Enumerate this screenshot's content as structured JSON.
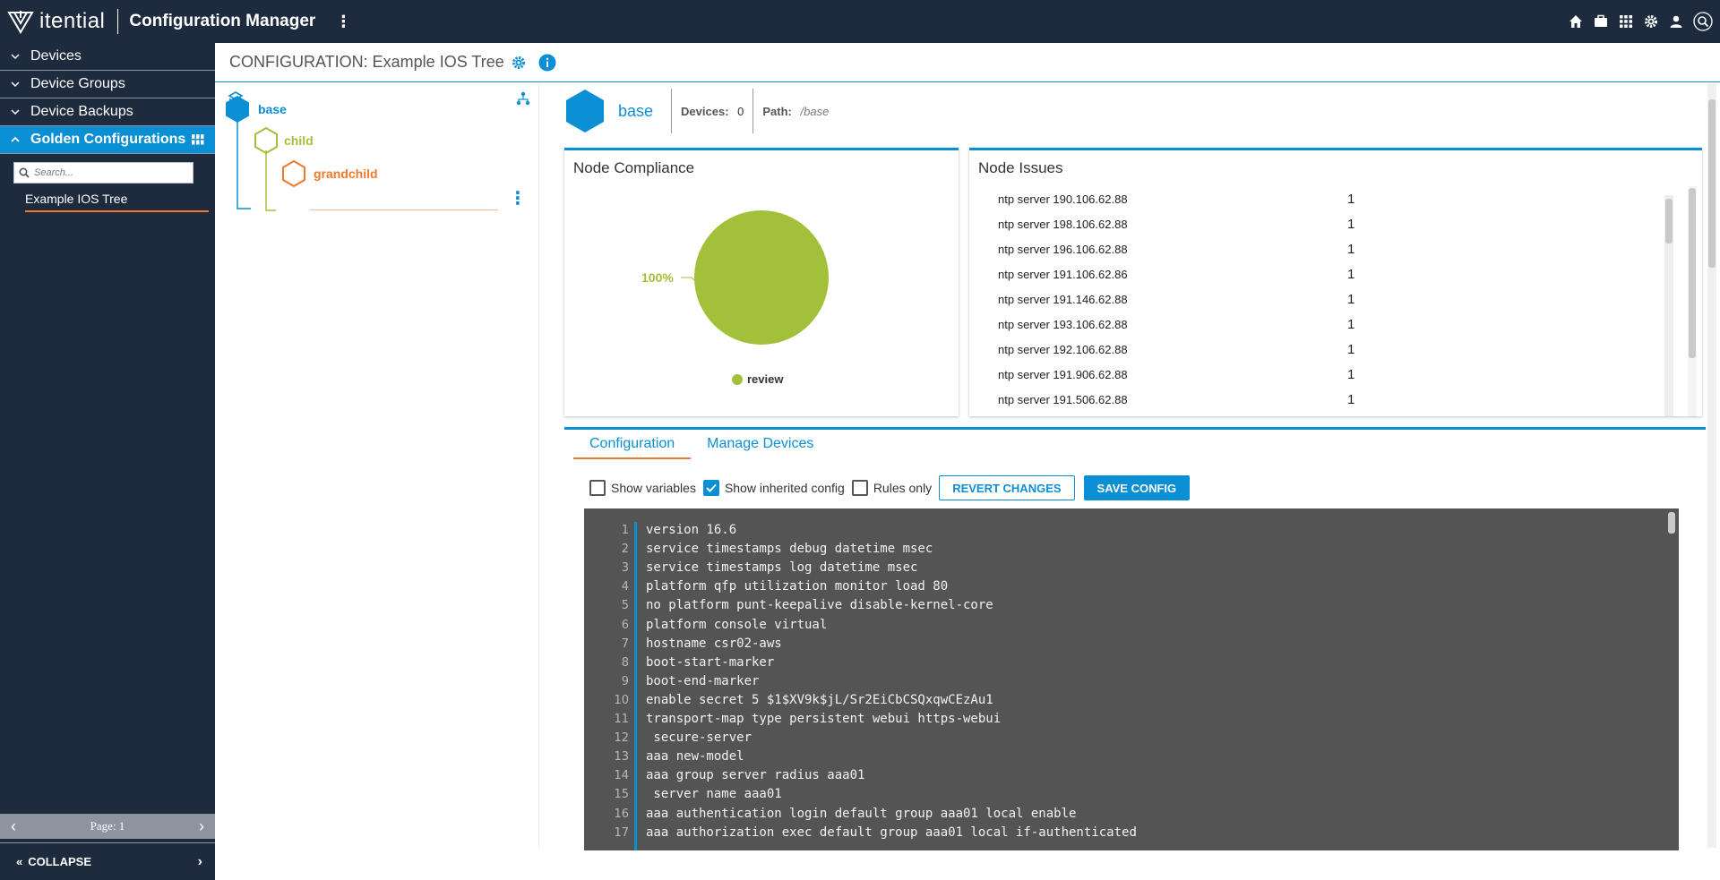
{
  "app": {
    "logo_text": "itential",
    "title": "Configuration Manager"
  },
  "topbar": {
    "icons": [
      "home-icon",
      "briefcase-icon",
      "apps-grid-icon",
      "settings-gear-icon",
      "user-icon",
      "search-icon"
    ]
  },
  "sidebar": {
    "items": [
      {
        "label": "Devices",
        "expanded": false
      },
      {
        "label": "Device Groups",
        "expanded": false
      },
      {
        "label": "Device Backups",
        "expanded": false
      },
      {
        "label": "Golden Configurations",
        "expanded": true
      }
    ],
    "search_placeholder": "Search...",
    "trees": [
      {
        "label": "Example IOS Tree"
      }
    ],
    "pager_label": "Page: 1",
    "collapse_label": "COLLAPSE"
  },
  "header": {
    "title": "CONFIGURATION: Example IOS Tree"
  },
  "tree": {
    "nodes": [
      {
        "label": "base",
        "color": "#0a8fd4"
      },
      {
        "label": "child",
        "color": "#a3c03b"
      },
      {
        "label": "grandchild",
        "color": "#f2792c"
      }
    ]
  },
  "node_info": {
    "name": "base",
    "devices_label": "Devices:",
    "devices_value": "0",
    "path_label": "Path:",
    "path_value": "/base"
  },
  "compliance": {
    "title": "Node Compliance",
    "percent_label": "100%",
    "legend_label": "review"
  },
  "chart_data": {
    "type": "pie",
    "title": "Node Compliance",
    "slices": [
      {
        "label": "review",
        "value": 100,
        "color": "#a3c03b"
      }
    ]
  },
  "issues": {
    "title": "Node Issues",
    "rows": [
      {
        "text": "ntp server 190.106.62.88",
        "count": "1"
      },
      {
        "text": "ntp server 198.106.62.88",
        "count": "1"
      },
      {
        "text": "ntp server 196.106.62.88",
        "count": "1"
      },
      {
        "text": "ntp server 191.106.62.86",
        "count": "1"
      },
      {
        "text": "ntp server 191.146.62.88",
        "count": "1"
      },
      {
        "text": "ntp server 193.106.62.88",
        "count": "1"
      },
      {
        "text": "ntp server 192.106.62.88",
        "count": "1"
      },
      {
        "text": "ntp server 191.906.62.88",
        "count": "1"
      },
      {
        "text": "ntp server 191.506.62.88",
        "count": "1"
      }
    ]
  },
  "config": {
    "tabs": [
      {
        "label": "Configuration",
        "active": true
      },
      {
        "label": "Manage Devices",
        "active": false
      }
    ],
    "options": {
      "show_variables": "Show variables",
      "show_inherited": "Show inherited config",
      "rules_only": "Rules only"
    },
    "revert_label": "REVERT CHANGES",
    "save_label": "SAVE CONFIG",
    "lines": [
      "version 16.6",
      "service timestamps debug datetime msec",
      "service timestamps log datetime msec",
      "platform qfp utilization monitor load 80",
      "no platform punt-keepalive disable-kernel-core",
      "platform console virtual",
      "hostname csr02-aws",
      "boot-start-marker",
      "boot-end-marker",
      "enable secret 5 $1$XV9k$jL/Sr2EiCbCSQxqwCEzAu1",
      "transport-map type persistent webui https-webui",
      " secure-server",
      "aaa new-model",
      "aaa group server radius aaa01",
      " server name aaa01",
      "aaa authentication login default group aaa01 local enable",
      "aaa authorization exec default group aaa01 local if-authenticated"
    ]
  }
}
